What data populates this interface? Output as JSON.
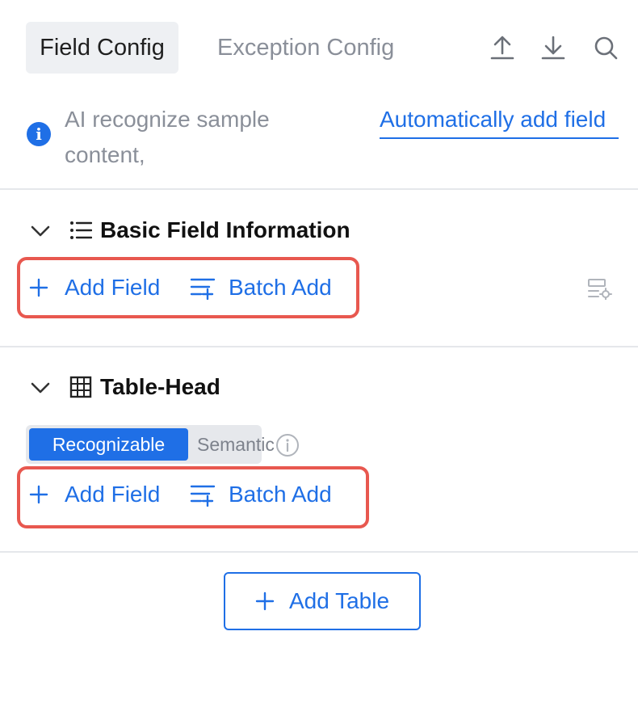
{
  "tabs": {
    "field_config": "Field Config",
    "exception_config": "Exception Config"
  },
  "header_icons": [
    "upload-icon",
    "download-icon",
    "search-icon"
  ],
  "notice": {
    "text": "AI recognize sample content,",
    "link": "Automatically add field"
  },
  "basic_section": {
    "title": "Basic Field Information",
    "add_field": "Add Field",
    "batch_add": "Batch Add"
  },
  "table_section": {
    "title": "Table-Head",
    "seg_recognizable": "Recognizable",
    "seg_semantic": "Semantic",
    "add_field": "Add Field",
    "batch_add": "Batch Add"
  },
  "add_table": "Add Table",
  "colors": {
    "accent": "#1f6fe6",
    "highlight": "#e8584f",
    "muted": "#8a8f99"
  }
}
